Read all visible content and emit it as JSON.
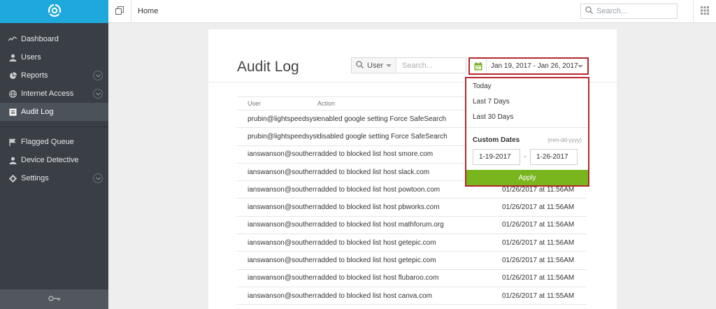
{
  "sidebar": {
    "logo_icon": "brand-logo-icon",
    "items": [
      {
        "label": "Dashboard",
        "icon": "activity-icon"
      },
      {
        "label": "Users",
        "icon": "user-icon"
      },
      {
        "label": "Reports",
        "icon": "pie-chart-icon",
        "expandable": true
      },
      {
        "label": "Internet Access",
        "icon": "globe-icon",
        "expandable": true
      },
      {
        "label": "Audit Log",
        "icon": "list-icon",
        "active": true
      },
      {
        "label": "Flagged Queue",
        "icon": "flag-icon"
      },
      {
        "label": "Device Detective",
        "icon": "user-icon"
      },
      {
        "label": "Settings",
        "icon": "gear-icon",
        "expandable": true
      }
    ],
    "footer_icon": "key-icon"
  },
  "topbar": {
    "breadcrumb": "Home",
    "search_placeholder": "Search..."
  },
  "page": {
    "title": "Audit Log",
    "filter": {
      "selected": "User",
      "search_placeholder": "Search..."
    },
    "date_range": "Jan 19, 2017 - Jan 26, 2017"
  },
  "table": {
    "headers": {
      "user": "User",
      "action": "Action",
      "date": ""
    },
    "rows": [
      {
        "user": "prubin@lightspeedsystems.com",
        "action": "enabled google setting Force SafeSearch",
        "date": ""
      },
      {
        "user": "prubin@lightspeedsystems.com",
        "action": "disabled google setting Force SafeSearch",
        "date": ""
      },
      {
        "user": "ianswanson@southernschools.org",
        "action": "added to blocked list host smore.com",
        "date": ""
      },
      {
        "user": "ianswanson@southernschools.org",
        "action": "added to blocked list host slack.com",
        "date": ""
      },
      {
        "user": "ianswanson@southernschools.org",
        "action": "added to blocked list host powtoon.com",
        "date": "01/26/2017 at 11:56AM"
      },
      {
        "user": "ianswanson@southernschools.org",
        "action": "added to blocked list host pbworks.com",
        "date": "01/26/2017 at 11:56AM"
      },
      {
        "user": "ianswanson@southernschools.org",
        "action": "added to blocked list host mathforum.org",
        "date": "01/26/2017 at 11:56AM"
      },
      {
        "user": "ianswanson@southernschools.org",
        "action": "added to blocked list host getepic.com",
        "date": "01/26/2017 at 11:56AM"
      },
      {
        "user": "ianswanson@southernschools.org",
        "action": "added to blocked list host getepic.com",
        "date": "01/26/2017 at 11:56AM"
      },
      {
        "user": "ianswanson@southernschools.org",
        "action": "added to blocked list host flubaroo.com",
        "date": "01/26/2017 at 11:56AM"
      },
      {
        "user": "ianswanson@southernschools.org",
        "action": "added to blocked list host canva.com",
        "date": "01/26/2017 at 11:55AM"
      }
    ]
  },
  "date_picker": {
    "presets": [
      "Today",
      "Last 7 Days",
      "Last 30 Days"
    ],
    "custom_label": "Custom Dates",
    "custom_hint": "(mm-dd-yyyy)",
    "start": "1-19-2017",
    "end": "1-26-2017",
    "dash": "-",
    "apply_label": "Apply"
  },
  "colors": {
    "sidebar": "#3a3f46",
    "brand": "#1fa8dc",
    "apply": "#79b51c",
    "highlight": "#b4282c"
  }
}
